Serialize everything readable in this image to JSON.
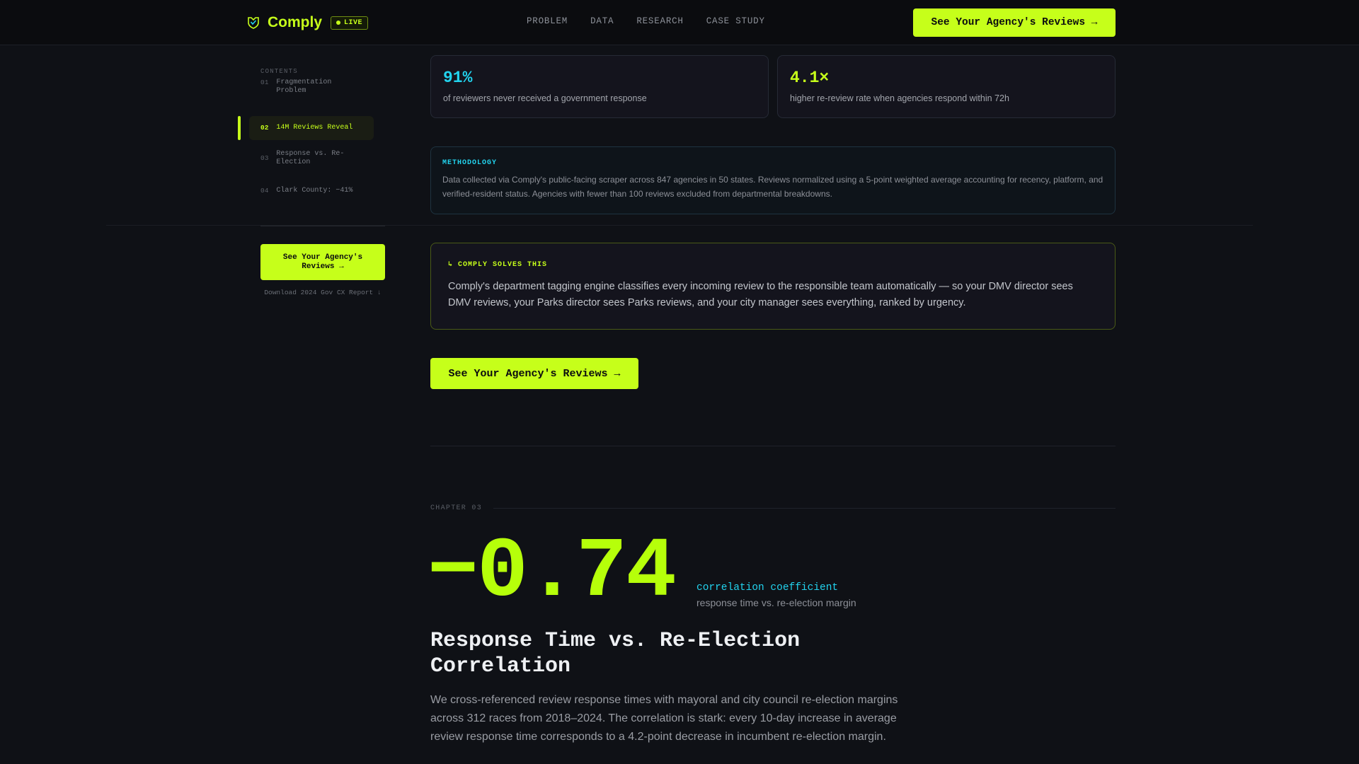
{
  "nav": {
    "brand": "Comply",
    "badge": "LIVE",
    "links": [
      "PROBLEM",
      "DATA",
      "RESEARCH",
      "CASE STUDY"
    ],
    "cta": "See Your Agency's Reviews →",
    "accent": "#c6ff1a"
  },
  "sidebar": {
    "label": "CONTENTS",
    "items": [
      {
        "num": "01",
        "label": "Fragmentation Problem"
      },
      {
        "num": "02",
        "label": "14M Reviews Reveal"
      },
      {
        "num": "03",
        "label": "Response vs. Re-Election"
      },
      {
        "num": "04",
        "label": "Clark County: −41%"
      }
    ],
    "active_index": 1,
    "cta": "See Your Agency's Reviews →",
    "download": "Download 2024 Gov CX Report ↓"
  },
  "stats": [
    {
      "value": "91%",
      "desc": "of reviewers never received a government response",
      "color": "#22d3ee"
    },
    {
      "value": "4.1×",
      "desc": "higher re-review rate when agencies respond within 72h",
      "color": "#c6ff1a"
    }
  ],
  "methodology": {
    "title": "METHODOLOGY",
    "text": "Data collected via Comply's public-facing scraper across 847 agencies in 50 states. Reviews normalized using a 5-point weighted average accounting for recency, platform, and verified-resident status. Agencies with fewer than 100 reviews excluded from departmental breakdowns."
  },
  "solves": {
    "title": "↳ COMPLY SOLVES THIS",
    "text": "Comply's department tagging engine classifies every incoming review to the responsible team automatically — so your DMV director sees DMV reviews, your Parks director sees Parks reviews, and your city manager sees everything, ranked by urgency."
  },
  "main_cta": "See Your Agency's Reviews →",
  "chapter": {
    "label": "CHAPTER 03",
    "big_number": "−0.74",
    "coef_label": "correlation coefficient",
    "coef_sub": "response time vs. re-election margin",
    "title": "Response Time vs. Re-Election Correlation",
    "body": "We cross-referenced review response times with mayoral and city council re-election margins across 312 races from 2018–2024. The correlation is stark: every 10-day increase in average review response time corresponds to a 4.2-point decrease in incumbent re-election margin."
  }
}
